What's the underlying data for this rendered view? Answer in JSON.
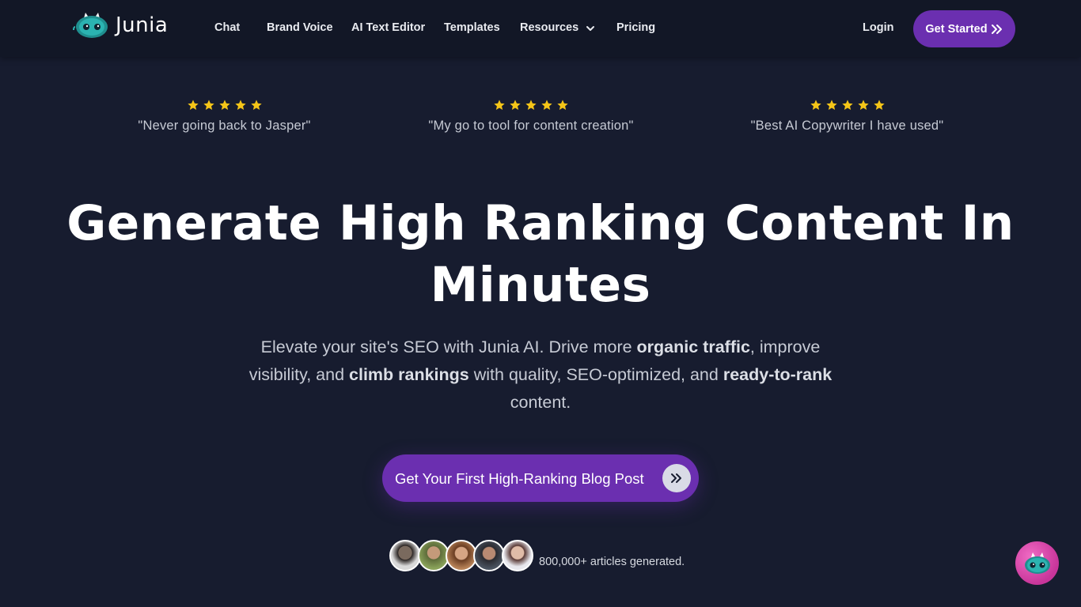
{
  "brand": {
    "name": "Junia"
  },
  "nav": {
    "links": [
      "Chat",
      "Brand Voice",
      "AI Text Editor",
      "Templates",
      "Resources",
      "Pricing"
    ],
    "login": "Login",
    "cta": "Get Started"
  },
  "testimonials": [
    {
      "rating": 5,
      "quote": "\"Never going back to Jasper\""
    },
    {
      "rating": 5,
      "quote": "\"My go to tool for content creation\""
    },
    {
      "rating": 5,
      "quote": "\"Best AI Copywriter I have used\""
    }
  ],
  "hero": {
    "title_line1": "Generate High Ranking Content In",
    "title_line2": "Minutes",
    "sub": {
      "p1": "Elevate your site's SEO with Junia AI. Drive more ",
      "b1": "organic traffic",
      "p2": ", improve visibility, and ",
      "b2": "climb rankings",
      "p3": " with quality, SEO-optimized, and ",
      "b3": "ready-to-rank",
      "p4": " content."
    },
    "cta": "Get Your First High-Ranking Blog Post"
  },
  "social_proof": {
    "text": "800,000+ articles generated."
  },
  "colors": {
    "background": "#171c2f",
    "nav": "#121726",
    "accent": "#6b2fb0",
    "star": "#f5c518",
    "chat": "#e052b3"
  },
  "icons": [
    "junia-logo-icon",
    "chevron-down-icon",
    "double-chevron-right-icon",
    "star-icon",
    "chat-robot-icon"
  ]
}
